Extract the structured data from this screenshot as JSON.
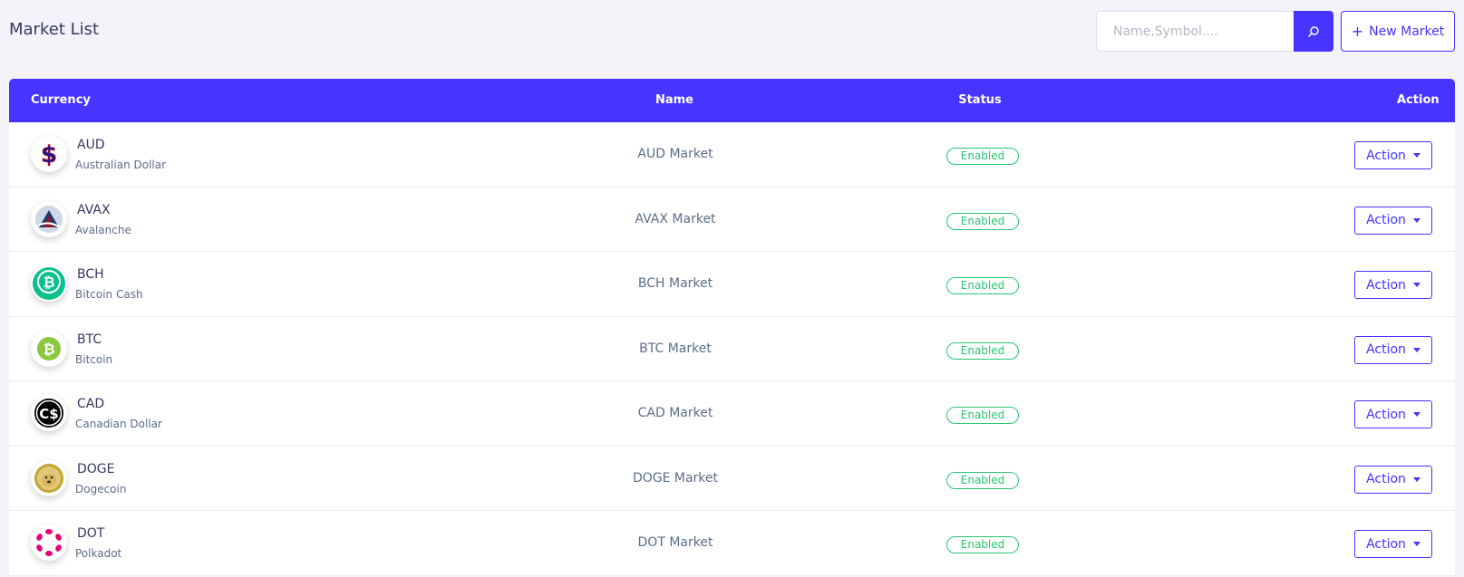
{
  "header": {
    "title": "Market List",
    "search_placeholder": "Name,Symbol....",
    "search_button_icon": "search-icon",
    "new_market_label": "New Market",
    "new_market_icon": "plus-icon"
  },
  "table": {
    "columns": [
      "Currency",
      "Name",
      "Status",
      "Action"
    ],
    "rows": [
      {
        "symbol": "AUD",
        "currency_name": "Australian Dollar",
        "market": "AUD Market",
        "status": "Enabled",
        "action": "Action",
        "icon": "dollar-sign-icon"
      },
      {
        "symbol": "AVAX",
        "currency_name": "Avalanche",
        "market": "AVAX Market",
        "status": "Enabled",
        "action": "Action",
        "icon": "avalanche-icon"
      },
      {
        "symbol": "BCH",
        "currency_name": "Bitcoin Cash",
        "market": "BCH Market",
        "status": "Enabled",
        "action": "Action",
        "icon": "bitcoin-cash-icon"
      },
      {
        "symbol": "BTC",
        "currency_name": "Bitcoin",
        "market": "BTC Market",
        "status": "Enabled",
        "action": "Action",
        "icon": "bitcoin-icon"
      },
      {
        "symbol": "CAD",
        "currency_name": "Canadian Dollar",
        "market": "CAD Market",
        "status": "Enabled",
        "action": "Action",
        "icon": "canadian-dollar-icon"
      },
      {
        "symbol": "DOGE",
        "currency_name": "Dogecoin",
        "market": "DOGE Market",
        "status": "Enabled",
        "action": "Action",
        "icon": "dogecoin-icon"
      },
      {
        "symbol": "DOT",
        "currency_name": "Polkadot",
        "market": "DOT Market",
        "status": "Enabled",
        "action": "Action",
        "icon": "polkadot-icon"
      }
    ]
  },
  "colors": {
    "accent": "#4634ff",
    "status_enabled": "#28c76f",
    "background": "#f3f3f9"
  }
}
